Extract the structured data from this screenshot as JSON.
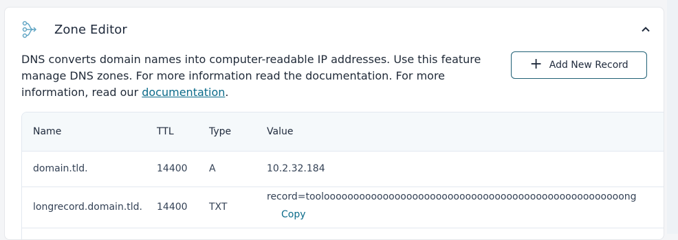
{
  "zone_editor": {
    "title": "Zone Editor",
    "description_text": "DNS converts domain names into computer-readable IP addresses. Use this feature manage DNS zones. For more information read the documentation. For more information, read our ",
    "description_link": "documentation",
    "description_end": ".",
    "add_button_label": "Add New Record",
    "icon": "dns-zone-icon",
    "collapse_icon": "chevron-up-icon"
  },
  "table": {
    "headers": [
      "Name",
      "TTL",
      "Type",
      "Value"
    ],
    "rows": [
      {
        "name": "domain.tld.",
        "ttl": "14400",
        "type": "A",
        "value": "10.2.32.184"
      },
      {
        "name": "longrecord.domain.tld.",
        "ttl": "14400",
        "type": "TXT",
        "value": "record=toolooooooooooooooooooooooooooooooooooooooooooooooooooong",
        "action": "Copy"
      }
    ]
  },
  "colors": {
    "accent": "#0b6b8a",
    "border": "#e2e8f0",
    "header_bg": "#f5f9fb"
  }
}
